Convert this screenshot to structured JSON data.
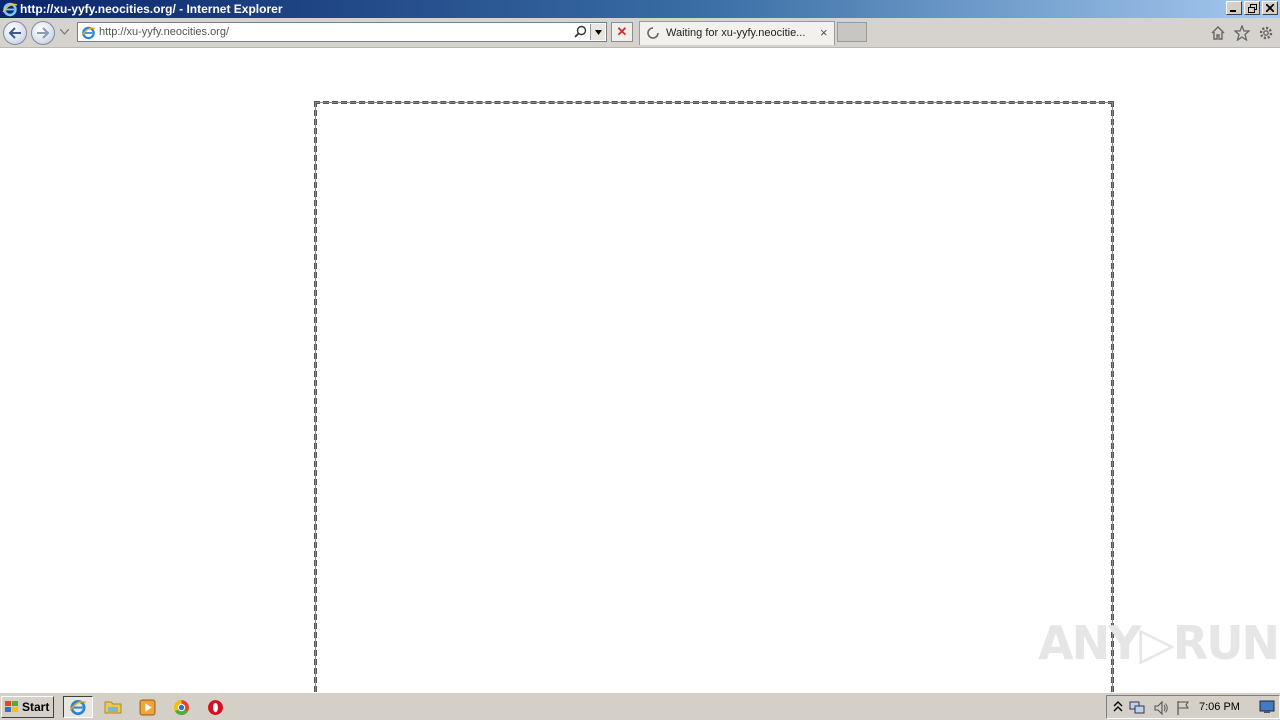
{
  "window": {
    "title": "http://xu-yyfy.neocities.org/ - Internet Explorer"
  },
  "toolbar": {
    "address_value": "http://xu-yyfy.neocities.org/",
    "tab_label": "Waiting for xu-yyfy.neocitie...",
    "tab_close": "×",
    "stop_symbol": "✕"
  },
  "page": {
    "watermark": "ANY▷RUN"
  },
  "taskbar": {
    "start_label": "Start",
    "clock": "7:06 PM"
  },
  "colors": {
    "titlebar_start": "#0a246a",
    "titlebar_end": "#a6caf0",
    "chrome": "#d4d0c8",
    "stop_red": "#d03030"
  }
}
